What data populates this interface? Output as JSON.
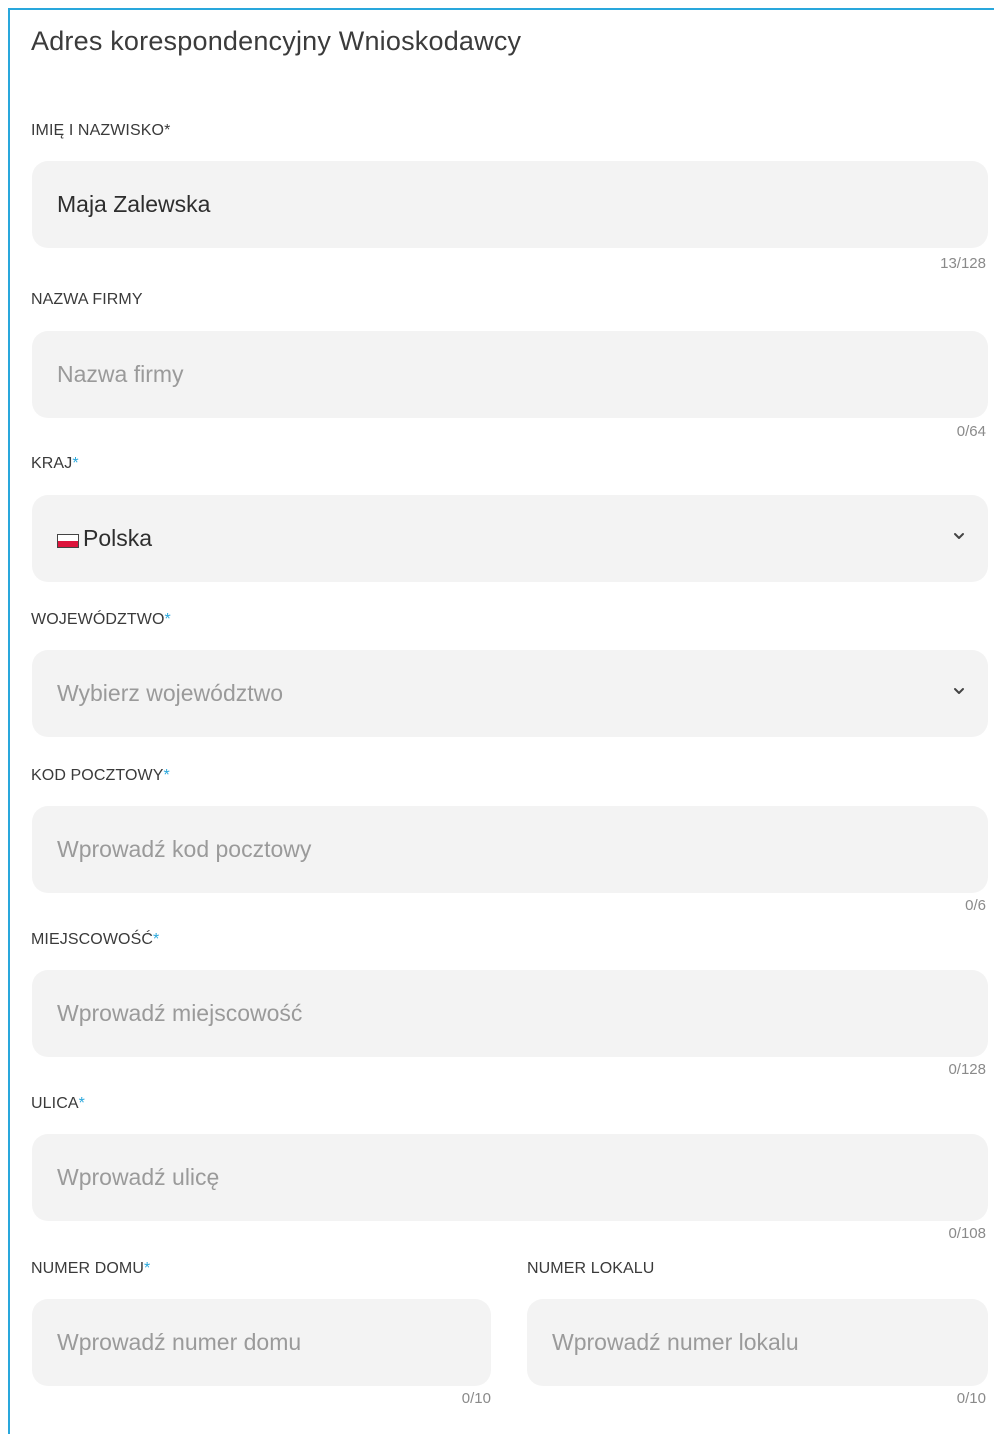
{
  "section": {
    "title": "Adres korespondencyjny Wnioskodawcy"
  },
  "fields": {
    "full_name": {
      "label": "IMIĘ I NAZWISKO",
      "required_mark": "*",
      "value": "Maja Zalewska",
      "placeholder": "",
      "counter": "13/128"
    },
    "company": {
      "label": "NAZWA FIRMY",
      "value": "",
      "placeholder": "Nazwa firmy",
      "counter": "0/64"
    },
    "country": {
      "label": "KRAJ",
      "required_mark": "*",
      "selected": "Polska",
      "flag_icon": "poland-flag-icon"
    },
    "voivodeship": {
      "label": "WOJEWÓDZTWO",
      "required_mark": "*",
      "placeholder": "Wybierz województwo"
    },
    "postal_code": {
      "label": "KOD POCZTOWY",
      "required_mark": "*",
      "value": "",
      "placeholder": "Wprowadź kod pocztowy",
      "counter": "0/6"
    },
    "city": {
      "label": "MIEJSCOWOŚĆ",
      "required_mark": "*",
      "value": "",
      "placeholder": "Wprowadź miejscowość",
      "counter": "0/128"
    },
    "street": {
      "label": "ULICA",
      "required_mark": "*",
      "value": "",
      "placeholder": "Wprowadź ulicę",
      "counter": "0/108"
    },
    "house_number": {
      "label": "NUMER DOMU",
      "required_mark": "*",
      "value": "",
      "placeholder": "Wprowadź numer domu",
      "counter": "0/10"
    },
    "apartment_number": {
      "label": "NUMER LOKALU",
      "value": "",
      "placeholder": "Wprowadź numer lokalu",
      "counter": "0/10"
    }
  },
  "colors": {
    "accent": "#29a7dc",
    "field_bg": "#f3f3f3",
    "placeholder": "#9a9a9a",
    "text": "#2e2e2e"
  },
  "icons": {
    "dropdown": "chevron-down-icon"
  }
}
